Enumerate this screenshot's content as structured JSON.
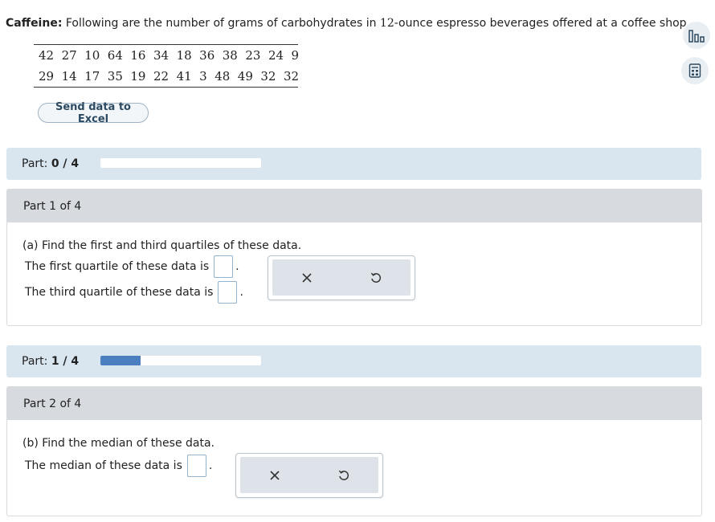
{
  "problem": {
    "label": "Caffeine:",
    "text_before": "Following are the number of grams of carbohydrates in",
    "number": "12",
    "text_after": "-ounce espresso beverages offered at a coffee shop."
  },
  "data_rows": [
    [
      "42",
      "27",
      "10",
      "64",
      "16",
      "34",
      "18",
      "36",
      "38",
      "23",
      "24",
      "9"
    ],
    [
      "29",
      "14",
      "17",
      "35",
      "19",
      "22",
      "41",
      "3",
      "48",
      "49",
      "32",
      "32"
    ]
  ],
  "excel_button": "Send data to Excel",
  "progress_sections": [
    {
      "label": "Part:",
      "value": "0 / 4",
      "progress_fraction": 0.0
    },
    {
      "label": "Part:",
      "value": "1 / 4",
      "progress_fraction": 0.25
    }
  ],
  "parts": [
    {
      "header": "Part 1 of 4",
      "question": "(a) Find the first and third quartiles of these data.",
      "answer_lines": [
        {
          "text": "The first quartile of these data is",
          "suffix": "."
        },
        {
          "text": "The third quartile of these data is",
          "suffix": "."
        }
      ]
    },
    {
      "header": "Part 2 of 4",
      "question": "(b) Find the median of these data.",
      "answer_lines": [
        {
          "text": "The median of these data is",
          "suffix": "."
        }
      ]
    }
  ],
  "icons": {
    "side_tools": [
      "bar-chart-icon",
      "calculator-icon"
    ],
    "actions": [
      "close-x-icon",
      "undo-icon"
    ]
  },
  "colors": {
    "part_bar_bg": "#d9e5ef",
    "progress_fill": "#4b7fbf",
    "part_header_bg": "#d7dbdf",
    "answer_box_border": "#8fb3cf"
  }
}
